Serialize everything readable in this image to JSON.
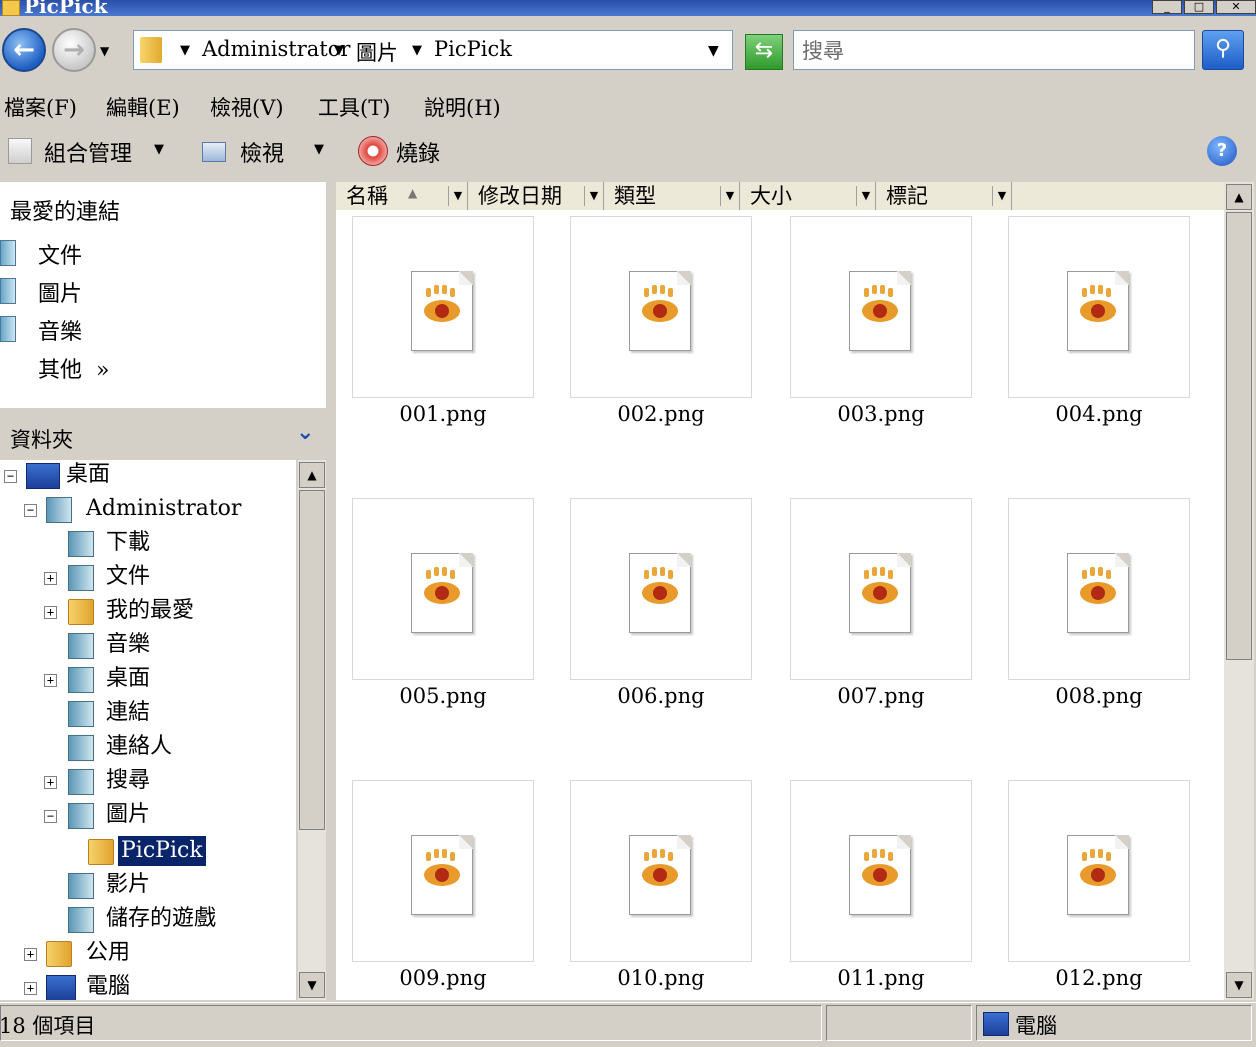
{
  "window": {
    "title": "PicPick"
  },
  "address": {
    "crumbs": [
      "Administrator",
      "圖片",
      "PicPick"
    ]
  },
  "search": {
    "placeholder": "搜尋"
  },
  "menu": [
    "檔案(F)",
    "編輯(E)",
    "檢視(V)",
    "工具(T)",
    "說明(H)"
  ],
  "toolbar": {
    "organize": "組合管理",
    "views": "檢視",
    "burn": "燒錄"
  },
  "favorites": {
    "title": "最愛的連結",
    "items": [
      "文件",
      "圖片",
      "音樂"
    ],
    "more": "其他",
    "more_arrow": "»"
  },
  "folders": {
    "title": "資料夾"
  },
  "tree": {
    "desktop": "桌面",
    "administrator": "Administrator",
    "downloads": "下載",
    "documents": "文件",
    "favorites": "我的最愛",
    "music": "音樂",
    "desktop2": "桌面",
    "links": "連結",
    "contacts": "連絡人",
    "searches": "搜尋",
    "pictures": "圖片",
    "picpick": "PicPick",
    "videos": "影片",
    "saved_games": "儲存的遊戲",
    "public": "公用",
    "computer": "電腦"
  },
  "columns": [
    "名稱",
    "修改日期",
    "類型",
    "大小",
    "標記"
  ],
  "files": [
    "001.png",
    "002.png",
    "003.png",
    "004.png",
    "005.png",
    "006.png",
    "007.png",
    "008.png",
    "009.png",
    "010.png",
    "011.png",
    "012.png"
  ],
  "status": {
    "count": "18 個項目",
    "location": "電腦"
  }
}
